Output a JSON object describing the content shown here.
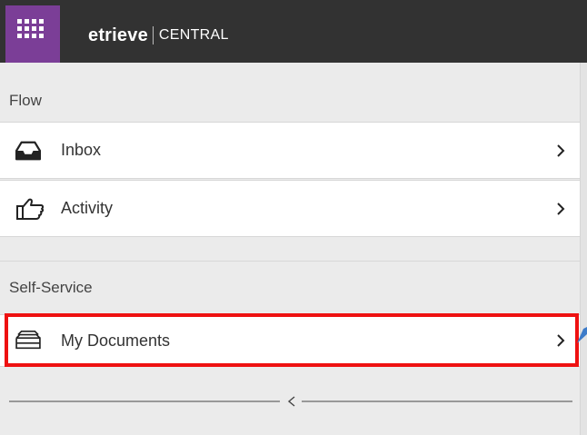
{
  "header": {
    "logo_text": "etrieve",
    "product_text": "CENTRAL",
    "colors": {
      "bar": "#323232",
      "launcher": "#7b3e97"
    },
    "launcher_icon": "grid-icon"
  },
  "sections": {
    "flow": {
      "title": "Flow",
      "items": [
        {
          "label": "Inbox",
          "icon": "inbox-tray-icon"
        },
        {
          "label": "Activity",
          "icon": "thumbs-up-icon"
        }
      ]
    },
    "self_service": {
      "title": "Self-Service",
      "items": [
        {
          "label": "My Documents",
          "icon": "documents-stack-icon",
          "highlighted": true
        }
      ]
    }
  },
  "collapse": {
    "icon": "chevron-left-icon",
    "glyph": "<"
  },
  "annotation": {
    "highlight_color": "#ee1111",
    "arrow_color": "#3d7cc9"
  }
}
